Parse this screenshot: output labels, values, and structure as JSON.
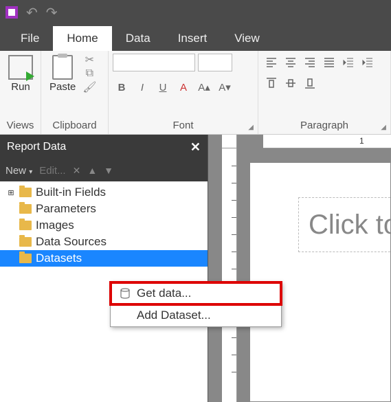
{
  "qat": {
    "undo_title": "Undo",
    "redo_title": "Redo"
  },
  "tabs": {
    "file": "File",
    "home": "Home",
    "data": "Data",
    "insert": "Insert",
    "view": "View"
  },
  "ribbon": {
    "views": {
      "run": "Run",
      "label": "Views"
    },
    "clipboard": {
      "paste": "Paste",
      "label": "Clipboard"
    },
    "font": {
      "label": "Font"
    },
    "paragraph": {
      "label": "Paragraph"
    }
  },
  "panel": {
    "title": "Report Data",
    "new": "New",
    "edit": "Edit...",
    "tree": {
      "builtin": "Built-in Fields",
      "parameters": "Parameters",
      "images": "Images",
      "datasources": "Data Sources",
      "datasets": "Datasets"
    }
  },
  "canvas": {
    "title_placeholder": "Click to",
    "ruler_1": "1"
  },
  "context": {
    "get_data": "Get data...",
    "add_dataset": "Add Dataset..."
  }
}
